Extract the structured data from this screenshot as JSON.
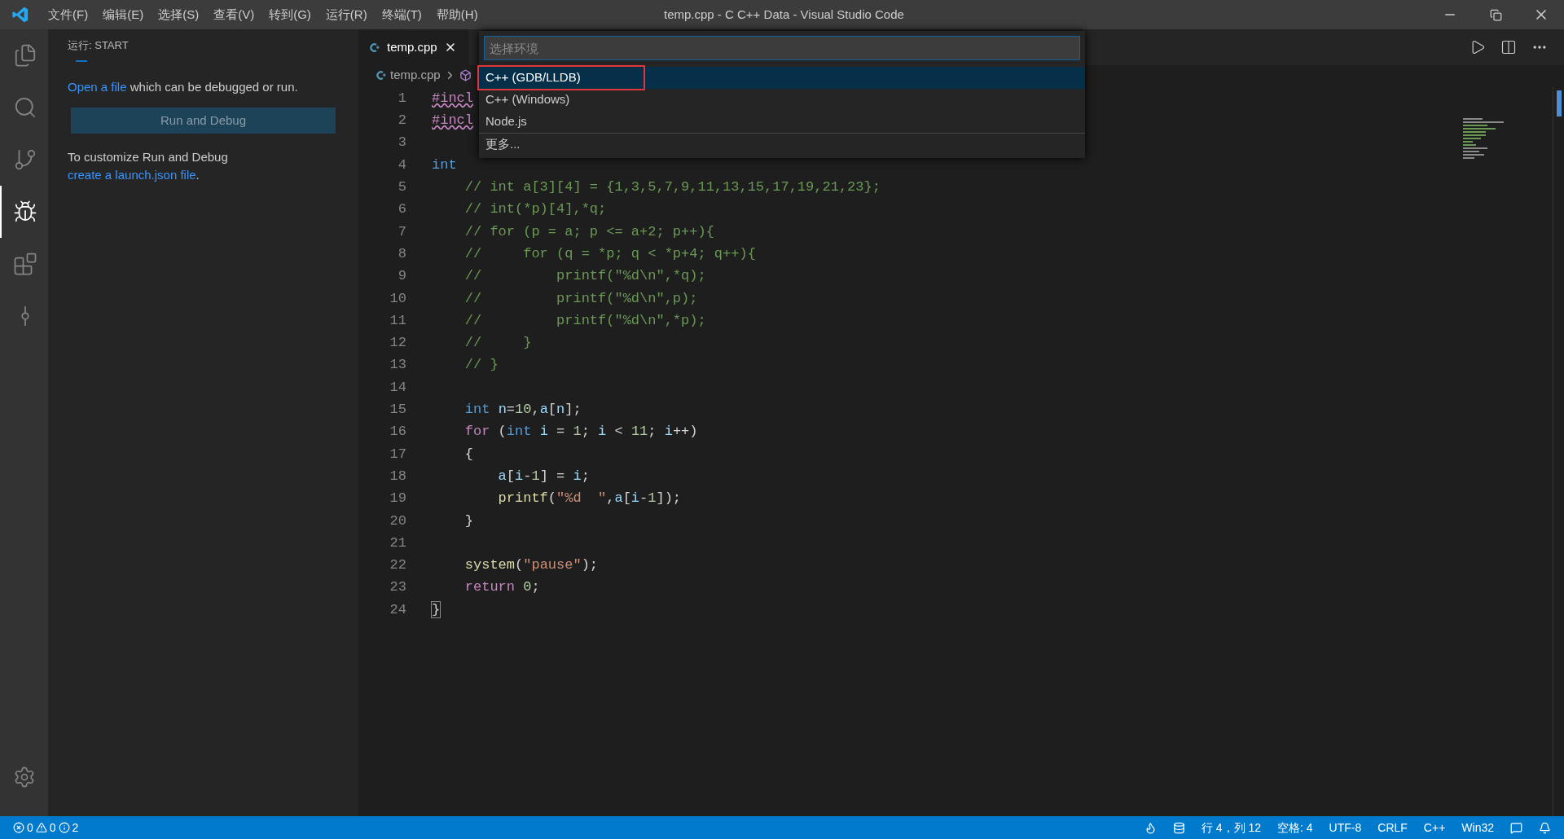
{
  "window": {
    "title": "temp.cpp - C C++ Data - Visual Studio Code"
  },
  "menu": [
    "文件(F)",
    "编辑(E)",
    "选择(S)",
    "查看(V)",
    "转到(G)",
    "运行(R)",
    "终端(T)",
    "帮助(H)"
  ],
  "activity_bar": [
    {
      "kind": "explorer",
      "selected": false
    },
    {
      "kind": "search",
      "selected": false
    },
    {
      "kind": "source-control",
      "selected": false
    },
    {
      "kind": "run-debug",
      "selected": true
    },
    {
      "kind": "extensions",
      "selected": false
    },
    {
      "kind": "git-graph",
      "selected": false
    }
  ],
  "sidebar": {
    "title": "运行: START",
    "intro": {
      "link": "Open a file",
      "text": " which can be debugged or run."
    },
    "button": "Run and Debug",
    "customize": {
      "text": "To customize Run and Debug ",
      "link": "create a launch.json file",
      "tail": "."
    }
  },
  "tabs": [
    {
      "label": "temp.cpp",
      "selected": true
    }
  ],
  "breadcrumb": [
    "temp.cpp"
  ],
  "quick_pick": {
    "placeholder": "选择环境",
    "items": [
      {
        "label": "C++ (GDB/LLDB)",
        "selected": true,
        "annotated": true,
        "separator_above": false
      },
      {
        "label": "C++ (Windows)",
        "selected": false,
        "annotated": false,
        "separator_above": false
      },
      {
        "label": "Node.js",
        "selected": false,
        "annotated": false,
        "separator_above": false
      },
      {
        "label": "更多...",
        "selected": false,
        "annotated": false,
        "separator_above": true
      }
    ]
  },
  "code": [
    {
      "number": "1",
      "tokens": [
        {
          "kind": "preproc",
          "text": "#incl"
        }
      ]
    },
    {
      "number": "2",
      "tokens": [
        {
          "kind": "preproc",
          "text": "#incl"
        }
      ]
    },
    {
      "number": "3"
    },
    {
      "number": "4",
      "tokens": [
        {
          "kind": "keyword",
          "text": "int"
        }
      ]
    },
    {
      "number": "5",
      "tokens": [
        {
          "kind": "comment",
          "text": "    // int a[3][4] = {1,3,5,7,9,11,13,15,17,19,21,23};"
        }
      ]
    },
    {
      "number": "6",
      "tokens": [
        {
          "kind": "comment",
          "text": "    // int(*p)[4],*q;"
        }
      ]
    },
    {
      "number": "7",
      "tokens": [
        {
          "kind": "comment",
          "text": "    // for (p = a; p <= a+2; p++){"
        }
      ]
    },
    {
      "number": "8",
      "tokens": [
        {
          "kind": "comment",
          "text": "    //     for (q = *p; q < *p+4; q++){"
        }
      ]
    },
    {
      "number": "9",
      "tokens": [
        {
          "kind": "comment",
          "text": "    //         printf(\"%d\\n\",*q);"
        }
      ]
    },
    {
      "number": "10",
      "tokens": [
        {
          "kind": "comment",
          "text": "    //         printf(\"%d\\n\",p);"
        }
      ]
    },
    {
      "number": "11",
      "tokens": [
        {
          "kind": "comment",
          "text": "    //         printf(\"%d\\n\",*p);"
        }
      ]
    },
    {
      "number": "12",
      "tokens": [
        {
          "kind": "comment",
          "text": "    //     }"
        }
      ]
    },
    {
      "number": "13",
      "tokens": [
        {
          "kind": "comment",
          "text": "    // }"
        }
      ]
    },
    {
      "number": "14"
    },
    {
      "number": "15",
      "tokens": [
        {
          "kind": "keyword",
          "text": "    int "
        },
        {
          "kind": "variable",
          "text": "n"
        },
        {
          "kind": "plain",
          "text": "="
        },
        {
          "kind": "number",
          "text": "10"
        },
        {
          "kind": "plain",
          "text": ","
        },
        {
          "kind": "variable",
          "text": "a"
        },
        {
          "kind": "plain",
          "text": "["
        },
        {
          "kind": "variable",
          "text": "n"
        },
        {
          "kind": "plain",
          "text": "];"
        }
      ]
    },
    {
      "number": "16",
      "tokens": [
        {
          "kind": "control",
          "text": "    for"
        },
        {
          "kind": "plain",
          "text": " ("
        },
        {
          "kind": "keyword",
          "text": "int "
        },
        {
          "kind": "variable",
          "text": "i"
        },
        {
          "kind": "plain",
          "text": " = "
        },
        {
          "kind": "number",
          "text": "1"
        },
        {
          "kind": "plain",
          "text": "; "
        },
        {
          "kind": "variable",
          "text": "i"
        },
        {
          "kind": "plain",
          "text": " < "
        },
        {
          "kind": "number",
          "text": "11"
        },
        {
          "kind": "plain",
          "text": "; "
        },
        {
          "kind": "variable",
          "text": "i"
        },
        {
          "kind": "plain",
          "text": "++)"
        }
      ]
    },
    {
      "number": "17",
      "tokens": [
        {
          "kind": "plain",
          "text": "    {"
        }
      ]
    },
    {
      "number": "18",
      "tokens": [
        {
          "kind": "variable",
          "text": "        a"
        },
        {
          "kind": "plain",
          "text": "["
        },
        {
          "kind": "variable",
          "text": "i"
        },
        {
          "kind": "plain",
          "text": "-"
        },
        {
          "kind": "number",
          "text": "1"
        },
        {
          "kind": "plain",
          "text": "] = "
        },
        {
          "kind": "variable",
          "text": "i"
        },
        {
          "kind": "plain",
          "text": ";"
        }
      ]
    },
    {
      "number": "19",
      "tokens": [
        {
          "kind": "function",
          "text": "        printf"
        },
        {
          "kind": "plain",
          "text": "("
        },
        {
          "kind": "string",
          "text": "\"%d  \""
        },
        {
          "kind": "plain",
          "text": ","
        },
        {
          "kind": "variable",
          "text": "a"
        },
        {
          "kind": "plain",
          "text": "["
        },
        {
          "kind": "variable",
          "text": "i"
        },
        {
          "kind": "plain",
          "text": "-"
        },
        {
          "kind": "number",
          "text": "1"
        },
        {
          "kind": "plain",
          "text": "]);"
        }
      ]
    },
    {
      "number": "20",
      "tokens": [
        {
          "kind": "plain",
          "text": "    }"
        }
      ]
    },
    {
      "number": "21"
    },
    {
      "number": "22",
      "tokens": [
        {
          "kind": "function",
          "text": "    system"
        },
        {
          "kind": "plain",
          "text": "("
        },
        {
          "kind": "string",
          "text": "\"pause\""
        },
        {
          "kind": "plain",
          "text": ");"
        }
      ]
    },
    {
      "number": "23",
      "tokens": [
        {
          "kind": "control",
          "text": "    return "
        },
        {
          "kind": "number",
          "text": "0"
        },
        {
          "kind": "plain",
          "text": ";"
        }
      ]
    },
    {
      "number": "24",
      "tokens": [
        {
          "kind": "bracket",
          "text": "}"
        }
      ]
    }
  ],
  "status_bar": {
    "errors": "0",
    "warnings": "0",
    "infos": "2",
    "right": [
      "行 4，列 12",
      "空格: 4",
      "UTF-8",
      "CRLF",
      "C++",
      "Win32"
    ]
  }
}
